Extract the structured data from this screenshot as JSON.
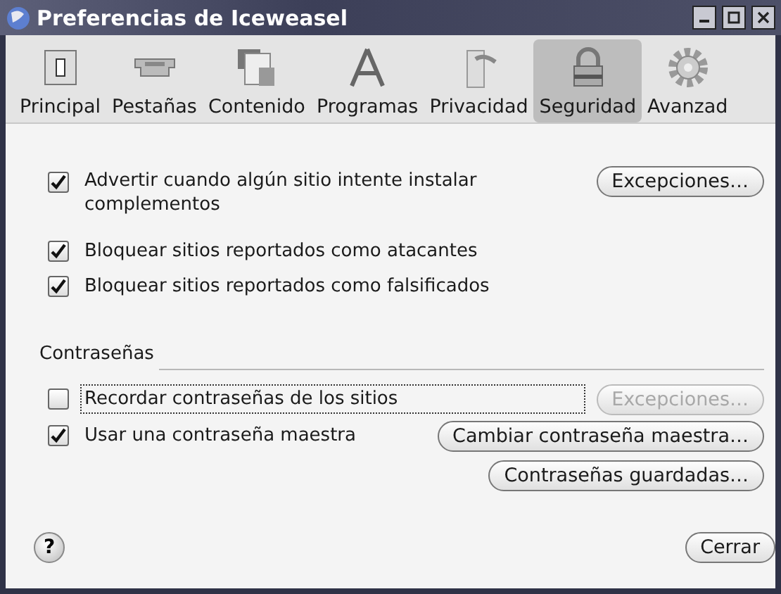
{
  "window": {
    "title": "Preferencias de Iceweasel"
  },
  "tabs": [
    {
      "label": "Principal",
      "kind": "switch",
      "selected": false
    },
    {
      "label": "Pestañas",
      "kind": "tab",
      "selected": false
    },
    {
      "label": "Contenido",
      "kind": "document",
      "selected": false
    },
    {
      "label": "Programas",
      "kind": "compass",
      "selected": false
    },
    {
      "label": "Privacidad",
      "kind": "door",
      "selected": false
    },
    {
      "label": "Seguridad",
      "kind": "lock",
      "selected": true
    },
    {
      "label": "Avanzad",
      "kind": "gear",
      "selected": false
    }
  ],
  "general": {
    "options": [
      {
        "label": "Advertir cuando algún sitio intente instalar complementos",
        "checked": true,
        "button": {
          "label": "Excepciones…",
          "disabled": false
        }
      },
      {
        "label": "Bloquear sitios reportados como atacantes",
        "checked": true
      },
      {
        "label": "Bloquear sitios reportados como falsificados",
        "checked": true
      }
    ]
  },
  "passwords": {
    "heading": "Contraseñas",
    "options": [
      {
        "label": "Recordar contraseñas de los sitios",
        "checked": false,
        "focused": true,
        "button": {
          "label": "Excepciones…",
          "disabled": true
        }
      },
      {
        "label": "Usar una contraseña maestra",
        "checked": true,
        "focused": false,
        "button": {
          "label": "Cambiar contraseña maestra…",
          "disabled": false
        }
      }
    ],
    "extra_button": {
      "label": "Contraseñas guardadas…"
    }
  },
  "footer": {
    "help": "?",
    "close": "Cerrar"
  }
}
